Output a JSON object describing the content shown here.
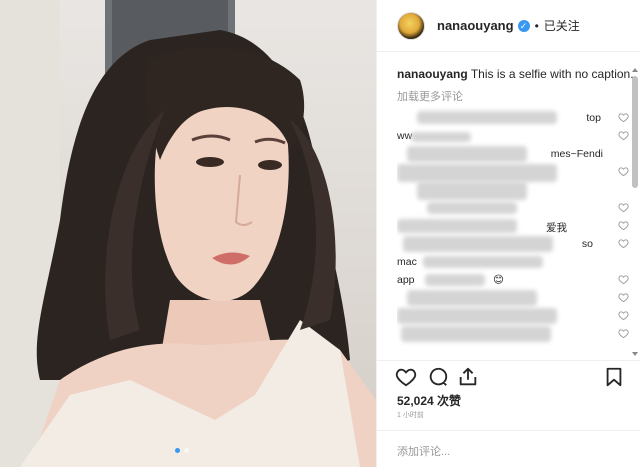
{
  "post": {
    "username": "nanaouyang",
    "verified_mark": "✓",
    "separator": "•",
    "follow_status": "已关注",
    "caption_username": "nanaouyang",
    "caption_text": "This is a selfie with no caption.",
    "load_more": "加载更多评论",
    "comment_fragments": [
      "top",
      "ww",
      "mes~Fendi",
      "爱我",
      "so",
      "mac",
      "app",
      "😊"
    ],
    "likes": "52,024 次赞",
    "time_ago": "1 小时前",
    "add_comment_placeholder": "添加评论...",
    "image_index": 1,
    "image_count": 2
  },
  "icons": {
    "like": "heart-icon",
    "comment": "comment-icon",
    "share": "share-icon",
    "save": "bookmark-icon",
    "verified": "verified-badge-icon"
  },
  "colors": {
    "verified_blue": "#3897f0",
    "text": "#262626",
    "muted": "#999999",
    "divider": "#efefef"
  }
}
